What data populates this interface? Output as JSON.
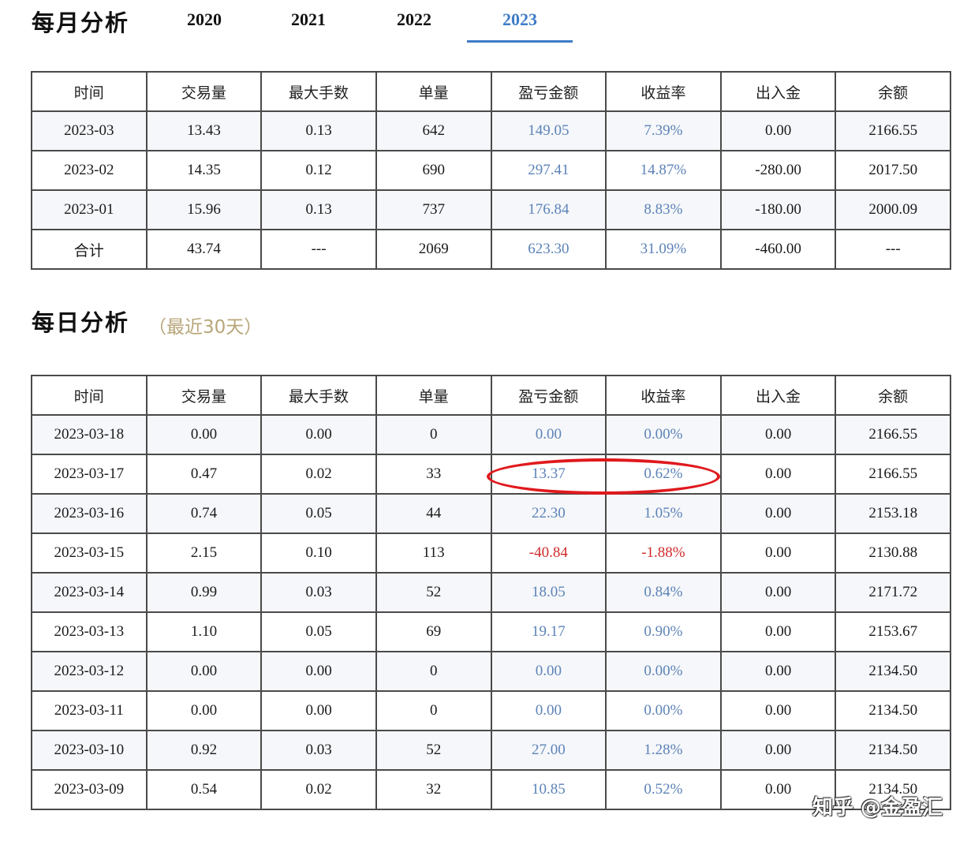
{
  "monthly": {
    "title": "每月分析",
    "tabs": [
      "2020",
      "2021",
      "2022",
      "2023"
    ],
    "active_tab": "2023",
    "headers": [
      "时间",
      "交易量",
      "最大手数",
      "单量",
      "盈亏金额",
      "收益率",
      "出入金",
      "余额"
    ],
    "rows": [
      {
        "cells": [
          "2023-03",
          "13.43",
          "0.13",
          "642",
          "149.05",
          "7.39%",
          "0.00",
          "2166.55"
        ],
        "tone": "blue"
      },
      {
        "cells": [
          "2023-02",
          "14.35",
          "0.12",
          "690",
          "297.41",
          "14.87%",
          "-280.00",
          "2017.50"
        ],
        "tone": "blue"
      },
      {
        "cells": [
          "2023-01",
          "15.96",
          "0.13",
          "737",
          "176.84",
          "8.83%",
          "-180.00",
          "2000.09"
        ],
        "tone": "blue"
      },
      {
        "cells": [
          "合计",
          "43.74",
          "---",
          "2069",
          "623.30",
          "31.09%",
          "-460.00",
          "---"
        ],
        "tone": "blue"
      }
    ]
  },
  "daily": {
    "title": "每日分析",
    "subtitle": "（最近30天）",
    "headers": [
      "时间",
      "交易量",
      "最大手数",
      "单量",
      "盈亏金额",
      "收益率",
      "出入金",
      "余额"
    ],
    "rows": [
      {
        "cells": [
          "2023-03-18",
          "0.00",
          "0.00",
          "0",
          "0.00",
          "0.00%",
          "0.00",
          "2166.55"
        ],
        "tone": "blue"
      },
      {
        "cells": [
          "2023-03-17",
          "0.47",
          "0.02",
          "33",
          "13.37",
          "0.62%",
          "0.00",
          "2166.55"
        ],
        "tone": "blue"
      },
      {
        "cells": [
          "2023-03-16",
          "0.74",
          "0.05",
          "44",
          "22.30",
          "1.05%",
          "0.00",
          "2153.18"
        ],
        "tone": "blue"
      },
      {
        "cells": [
          "2023-03-15",
          "2.15",
          "0.10",
          "113",
          "-40.84",
          "-1.88%",
          "0.00",
          "2130.88"
        ],
        "tone": "red"
      },
      {
        "cells": [
          "2023-03-14",
          "0.99",
          "0.03",
          "52",
          "18.05",
          "0.84%",
          "0.00",
          "2171.72"
        ],
        "tone": "blue"
      },
      {
        "cells": [
          "2023-03-13",
          "1.10",
          "0.05",
          "69",
          "19.17",
          "0.90%",
          "0.00",
          "2153.67"
        ],
        "tone": "blue"
      },
      {
        "cells": [
          "2023-03-12",
          "0.00",
          "0.00",
          "0",
          "0.00",
          "0.00%",
          "0.00",
          "2134.50"
        ],
        "tone": "blue"
      },
      {
        "cells": [
          "2023-03-11",
          "0.00",
          "0.00",
          "0",
          "0.00",
          "0.00%",
          "0.00",
          "2134.50"
        ],
        "tone": "blue"
      },
      {
        "cells": [
          "2023-03-10",
          "0.92",
          "0.03",
          "52",
          "27.00",
          "1.28%",
          "0.00",
          "2134.50"
        ],
        "tone": "blue"
      },
      {
        "cells": [
          "2023-03-09",
          "0.54",
          "0.02",
          "32",
          "10.85",
          "0.52%",
          "0.00",
          "2134.50"
        ],
        "tone": "blue"
      }
    ]
  },
  "watermark": "知乎 @金盈汇",
  "colors": {
    "accent": "#3d7cc8",
    "profit": "#5d83b8",
    "loss": "#d12b2b",
    "highlight": "#e0191d",
    "subtitle": "#b8a67a"
  }
}
